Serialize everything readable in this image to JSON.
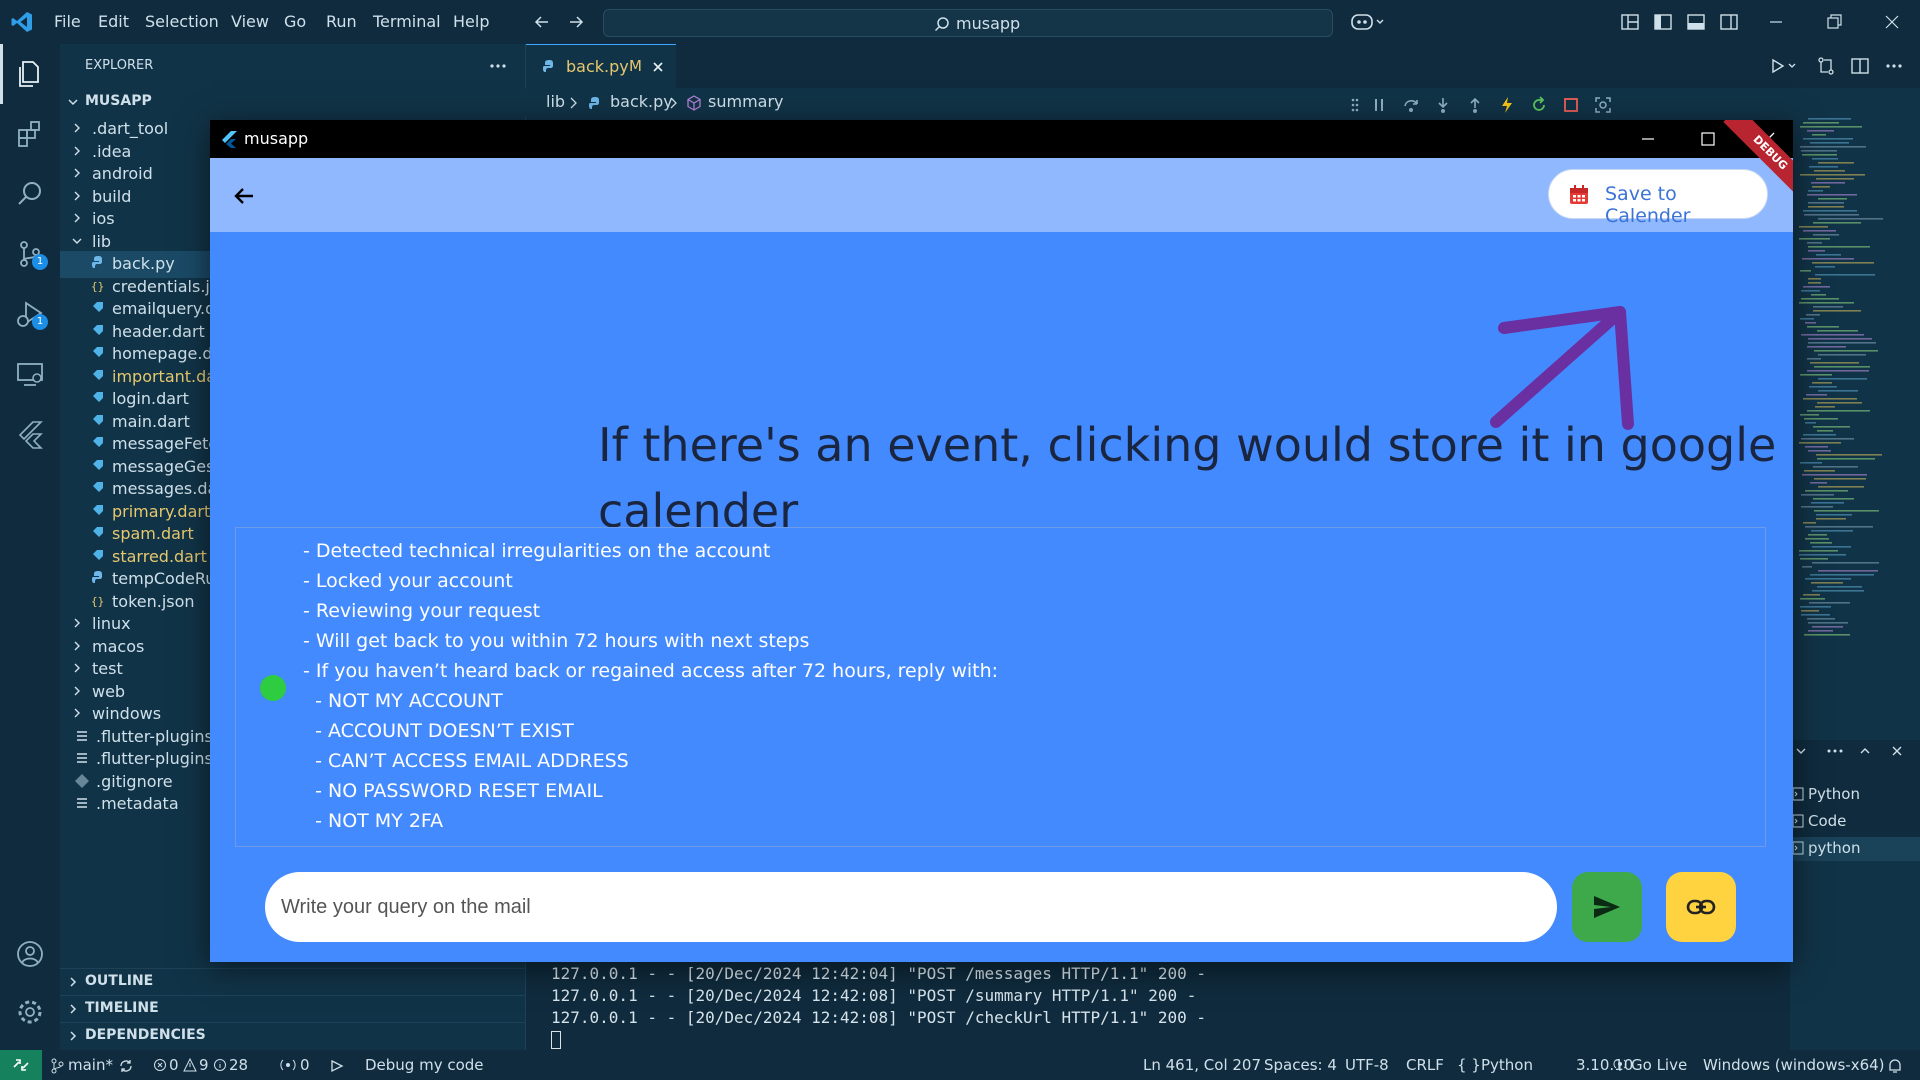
{
  "menu": [
    "File",
    "Edit",
    "Selection",
    "View",
    "Go",
    "Run",
    "Terminal",
    "Help"
  ],
  "search_label": "musapp",
  "explorer": {
    "title": "EXPLORER",
    "root": "MUSAPP",
    "items": [
      {
        "label": ".dart_tool",
        "kind": "folder"
      },
      {
        "label": ".idea",
        "kind": "folder"
      },
      {
        "label": "android",
        "kind": "folder"
      },
      {
        "label": "build",
        "kind": "folder"
      },
      {
        "label": "ios",
        "kind": "folder"
      },
      {
        "label": "lib",
        "kind": "folder-open"
      },
      {
        "label": "back.py",
        "kind": "py"
      },
      {
        "label": "credentials.jso",
        "kind": "json"
      },
      {
        "label": "emailquery.da",
        "kind": "dart"
      },
      {
        "label": "header.dart",
        "kind": "dart"
      },
      {
        "label": "homepage.da",
        "kind": "dart"
      },
      {
        "label": "important.dar",
        "kind": "dart-mod"
      },
      {
        "label": "login.dart",
        "kind": "dart"
      },
      {
        "label": "main.dart",
        "kind": "dart"
      },
      {
        "label": "messageFetch",
        "kind": "dart"
      },
      {
        "label": "messageGestu",
        "kind": "dart"
      },
      {
        "label": "messages.dar",
        "kind": "dart"
      },
      {
        "label": "primary.dart",
        "kind": "dart-mod"
      },
      {
        "label": "spam.dart",
        "kind": "dart-mod"
      },
      {
        "label": "starred.dart",
        "kind": "dart-mod"
      },
      {
        "label": "tempCodeRun",
        "kind": "py"
      },
      {
        "label": "token.json",
        "kind": "json"
      },
      {
        "label": "linux",
        "kind": "folder"
      },
      {
        "label": "macos",
        "kind": "folder"
      },
      {
        "label": "test",
        "kind": "folder"
      },
      {
        "label": "web",
        "kind": "folder"
      },
      {
        "label": "windows",
        "kind": "folder"
      },
      {
        "label": ".flutter-plugins",
        "kind": "file"
      },
      {
        "label": ".flutter-plugins",
        "kind": "file"
      },
      {
        "label": ".gitignore",
        "kind": "git"
      },
      {
        "label": ".metadata",
        "kind": "file"
      }
    ],
    "sections": [
      "OUTLINE",
      "TIMELINE",
      "DEPENDENCIES"
    ]
  },
  "activity_badges": {
    "source_control": "1",
    "run_debug": "1"
  },
  "tab": {
    "label": "back.py",
    "modified": "M"
  },
  "breadcrumb": {
    "lib": "lib",
    "file": "back.py",
    "symbol": "summary"
  },
  "panel_side": [
    "Python",
    "Code",
    "python"
  ],
  "terminal_lines": [
    "127.0.0.1 - - [20/Dec/2024 12:42:04] \"POST /messages HTTP/1.1\" 200 -",
    "127.0.0.1 - - [20/Dec/2024 12:42:08] \"POST /summary HTTP/1.1\" 200 -",
    "127.0.0.1 - - [20/Dec/2024 12:42:08] \"POST /checkUrl HTTP/1.1\" 200 -"
  ],
  "statusbar": {
    "branch": "main*",
    "errors": "0",
    "warnings": "9",
    "infos": "28",
    "ports": "0",
    "debug": "Debug my code",
    "position": "Ln 461, Col 207",
    "spaces": "Spaces: 4",
    "encoding": "UTF-8",
    "eol": "CRLF",
    "language": "Python",
    "version": "3.10.10",
    "golive": "Go Live",
    "platform": "Windows (windows-x64)"
  },
  "app": {
    "window_title": "musapp",
    "save_button": "Save to Calender",
    "debug_banner": "DEBUG",
    "annotation": "If there's an event, clicking would store it in google calender",
    "summary_lines": [
      "- Detected technical irregularities on the account",
      "- Locked your account",
      "- Reviewing your request",
      "- Will get back to you within 72 hours with next steps",
      "- If you haven’t heard back or regained access after 72 hours, reply with:",
      "  - NOT MY ACCOUNT",
      "  - ACCOUNT DOESN’T EXIST",
      "  - CAN’T ACCESS EMAIL ADDRESS",
      "  - NO PASSWORD RESET EMAIL",
      "  - NOT MY 2FA"
    ],
    "query_placeholder": "Write your query on the mail"
  },
  "colors": {
    "app_background": "#448aff",
    "appbar": "#8fb8ff",
    "annotation_arrow": "#6a2fa0",
    "send_button": "#3da94a",
    "link_button": "#ffd23f",
    "status_dot": "#2ecc40"
  }
}
